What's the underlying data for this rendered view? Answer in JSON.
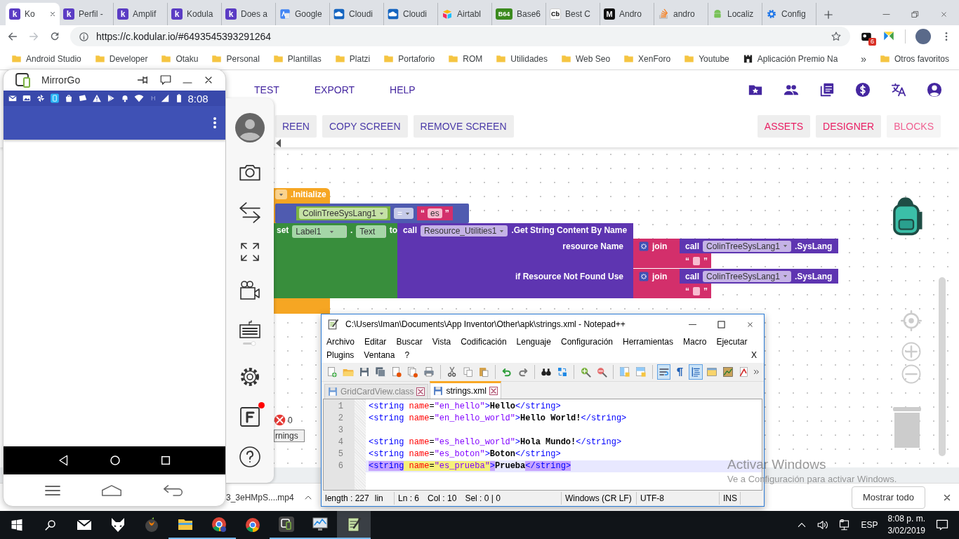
{
  "browser": {
    "tabs": [
      {
        "kind": "kodular",
        "icon_text": "k",
        "label": "Ko",
        "selected": true
      },
      {
        "kind": "kodular",
        "icon_text": "k",
        "label": "Perfil -",
        "selected": false
      },
      {
        "kind": "kodular",
        "icon_text": "k",
        "label": "Amplif",
        "selected": false
      },
      {
        "kind": "kodular",
        "icon_text": "k",
        "label": "Kodula",
        "selected": false
      },
      {
        "kind": "kodular",
        "icon_text": "k",
        "label": "Does a",
        "selected": false
      },
      {
        "kind": "translate",
        "label": "Google",
        "selected": false
      },
      {
        "kind": "cloud",
        "label": "Cloudi",
        "selected": false
      },
      {
        "kind": "cloud",
        "label": "Cloudi",
        "selected": false
      },
      {
        "kind": "airtable",
        "label": "Airtabl",
        "selected": false
      },
      {
        "kind": "b64",
        "icon_text": "B64",
        "label": "Base6",
        "selected": false
      },
      {
        "kind": "cb",
        "icon_text": "Cb",
        "label": "Best C",
        "selected": false
      },
      {
        "kind": "medium",
        "icon_text": "M",
        "label": "Andro",
        "selected": false
      },
      {
        "kind": "stack",
        "label": "andro",
        "selected": false
      },
      {
        "kind": "android",
        "label": "Localiz",
        "selected": false
      },
      {
        "kind": "gear",
        "label": "Config",
        "selected": false
      }
    ],
    "url": "https://c.kodular.io/#6493545393291264",
    "extensions": [
      {
        "kind": "puzzle",
        "badge": "6"
      },
      {
        "kind": "cross"
      }
    ],
    "bookmarks": [
      {
        "kind": "folder",
        "label": "Android Studio"
      },
      {
        "kind": "folder",
        "label": "Developer"
      },
      {
        "kind": "folder",
        "label": "Otaku"
      },
      {
        "kind": "folder",
        "label": "Personal"
      },
      {
        "kind": "folder",
        "label": "Plantillas"
      },
      {
        "kind": "folder",
        "label": "Platzi"
      },
      {
        "kind": "folder",
        "label": "Portaforio"
      },
      {
        "kind": "folder",
        "label": "ROM"
      },
      {
        "kind": "folder",
        "label": "Utilidades"
      },
      {
        "kind": "folder",
        "label": "Web Seo"
      },
      {
        "kind": "folder",
        "label": "XenForo"
      },
      {
        "kind": "folder",
        "label": "Youtube"
      },
      {
        "kind": "site",
        "label": "Aplicación Premio Na"
      }
    ],
    "more": "»",
    "other_bookmarks": "Otros favoritos"
  },
  "kodular": {
    "menu": [
      "TEST",
      "EXPORT",
      "HELP"
    ],
    "screen_buttons": [
      "REEN",
      "COPY SCREEN",
      "REMOVE SCREEN"
    ],
    "editor_buttons": [
      {
        "label": "ASSETS",
        "selected": false
      },
      {
        "label": "DESIGNER",
        "selected": false
      },
      {
        "label": "BLOCKS",
        "selected": true
      }
    ],
    "blocks": [
      {
        "kind": "event",
        "label": ".Initialize"
      },
      {
        "kind": "compare",
        "getter": "ColinTreeSysLang1",
        "operator": "=",
        "string": {
          "open": "“",
          "text": "es",
          "close": "”"
        }
      },
      {
        "kind": "setter",
        "verb": "set",
        "component": "Label1",
        "dot": ".",
        "property": "Text",
        "to": "to"
      },
      {
        "kind": "method",
        "verb": "call",
        "component": "Resource_Utilities1",
        "method": ".Get String Content By Name",
        "sockets": [
          {
            "label": "resource Name",
            "join": "join",
            "call": "call",
            "component": "ColinTreeSysLang1",
            "method": ".SysLang",
            "string": {
              "open": "“",
              "close": "”"
            }
          },
          {
            "label": "if Resource Not Found Use",
            "join": "join",
            "call": "call",
            "component": "ColinTreeSysLang1",
            "method": ".SysLang",
            "string": {
              "open": "“",
              "close": "”"
            }
          }
        ]
      }
    ],
    "warnings": {
      "errors": "0",
      "button": "rnings"
    }
  },
  "mirrorgo": {
    "title": "MirrorGo",
    "network": "H",
    "time": "8:08"
  },
  "notepad": {
    "title": "C:\\Users\\Iman\\Documents\\App Inventor\\Other\\apk\\strings.xml - Notepad++",
    "menu_rows": [
      [
        "Archivo",
        "Editar",
        "Buscar",
        "Vista",
        "Codificación",
        "Lenguaje",
        "Configuración",
        "Herramientas",
        "Macro",
        "Ejecutar"
      ],
      [
        "Plugins",
        "Ventana",
        "?"
      ]
    ],
    "close_doc": "X",
    "toolbar": [
      [
        {
          "kind": "new",
          "pressed": false
        },
        {
          "kind": "open",
          "pressed": false
        },
        {
          "kind": "save",
          "pressed": false
        },
        {
          "kind": "saveall",
          "pressed": false
        },
        {
          "kind": "close",
          "pressed": false
        },
        {
          "kind": "closeall",
          "pressed": false
        },
        {
          "kind": "print",
          "pressed": false
        }
      ],
      [
        {
          "kind": "cut",
          "pressed": false
        },
        {
          "kind": "copy",
          "pressed": false
        },
        {
          "kind": "paste",
          "pressed": false
        }
      ],
      [
        {
          "kind": "undo",
          "pressed": false
        },
        {
          "kind": "redo",
          "pressed": false
        }
      ],
      [
        {
          "kind": "find",
          "pressed": false
        },
        {
          "kind": "replace",
          "pressed": false
        }
      ],
      [
        {
          "kind": "zoomin",
          "pressed": false
        },
        {
          "kind": "zoomout",
          "pressed": false
        }
      ],
      [
        {
          "kind": "syncv",
          "pressed": false
        },
        {
          "kind": "synch",
          "pressed": false
        }
      ],
      [
        {
          "kind": "wrap",
          "pressed": true
        },
        {
          "kind": "pilcrow",
          "pressed": false
        },
        {
          "kind": "indent",
          "pressed": true
        },
        {
          "kind": "panel",
          "pressed": false
        },
        {
          "kind": "map",
          "pressed": false
        },
        {
          "kind": "record",
          "pressed": false
        }
      ]
    ],
    "tabs": [
      {
        "label": "GridCardView.class",
        "selected": false
      },
      {
        "label": "strings.xml",
        "selected": true
      }
    ],
    "lines": [
      {
        "number": "1",
        "current": false,
        "tokens": [
          {
            "kind": "tag",
            "text": "<string"
          },
          {
            "kind": "attr",
            "text": " name"
          },
          {
            "kind": "eq",
            "text": "="
          },
          {
            "kind": "value",
            "text": "\"en_hello\""
          },
          {
            "kind": "tag",
            "text": ">"
          },
          {
            "kind": "text",
            "text": "Hello"
          },
          {
            "kind": "tag",
            "text": "</string>"
          }
        ]
      },
      {
        "number": "2",
        "current": false,
        "tokens": [
          {
            "kind": "tag",
            "text": "<string"
          },
          {
            "kind": "attr",
            "text": " name"
          },
          {
            "kind": "eq",
            "text": "="
          },
          {
            "kind": "value",
            "text": "\"en_hello_world\""
          },
          {
            "kind": "tag",
            "text": ">"
          },
          {
            "kind": "text",
            "text": "Hello World!"
          },
          {
            "kind": "tag",
            "text": "</string>"
          }
        ]
      },
      {
        "number": "3",
        "current": false
      },
      {
        "number": "4",
        "current": false,
        "tokens": [
          {
            "kind": "tag",
            "text": "<string"
          },
          {
            "kind": "attr",
            "text": " name"
          },
          {
            "kind": "eq",
            "text": "="
          },
          {
            "kind": "value",
            "text": "\"es_hello_world\""
          },
          {
            "kind": "tag",
            "text": ">"
          },
          {
            "kind": "text",
            "text": "Hola Mundo!"
          },
          {
            "kind": "tag",
            "text": "</string>"
          }
        ]
      },
      {
        "number": "5",
        "current": false,
        "tokens": [
          {
            "kind": "tag",
            "text": "<string"
          },
          {
            "kind": "attr",
            "text": " name"
          },
          {
            "kind": "eq",
            "text": "="
          },
          {
            "kind": "value",
            "text": "\"es_boton\""
          },
          {
            "kind": "tag",
            "text": ">"
          },
          {
            "kind": "text",
            "text": "Boton"
          },
          {
            "kind": "tag",
            "text": "</string>"
          }
        ]
      },
      {
        "number": "6",
        "current": true,
        "tokens": [
          {
            "kind": "tag",
            "text": "<string",
            "tag_match": true
          },
          {
            "kind": "attr",
            "text": " name",
            "word_match": true
          },
          {
            "kind": "eq",
            "text": "=",
            "word_match": true
          },
          {
            "kind": "value",
            "text": "\"es_prueba\"",
            "word_match": true
          },
          {
            "kind": "tag",
            "text": ">",
            "tag_match": true
          },
          {
            "kind": "text",
            "text": "Prueba"
          },
          {
            "kind": "tag",
            "text": "</string>",
            "tag_match": true
          }
        ]
      }
    ],
    "status": [
      [
        "length : 227",
        "lin"
      ],
      [
        "Ln : 6",
        "Col : 10",
        "Sel : 0 | 0"
      ],
      [
        "Windows (CR LF)"
      ],
      [
        "UTF-8"
      ],
      [
        "INS"
      ]
    ]
  },
  "downloads": {
    "file": "3_3eHMpS....mp4",
    "show_all": "Mostrar todo"
  },
  "activation": {
    "title": "Activar Windows",
    "message": "Ve a Configuración para activar Windows."
  },
  "taskbar": {
    "apps": [
      {
        "kind": "mail",
        "running": false,
        "active": false
      },
      {
        "kind": "fox",
        "running": false,
        "active": false
      },
      {
        "kind": "fl",
        "running": false,
        "active": false
      },
      {
        "kind": "explorer",
        "running": true,
        "active": false
      },
      {
        "kind": "chromeprofile",
        "running": true,
        "active": false
      },
      {
        "kind": "chrome",
        "running": false,
        "active": false
      },
      {
        "kind": "mirrorgo",
        "running": true,
        "active": false
      },
      {
        "kind": "perfmon",
        "running": true,
        "active": false
      },
      {
        "kind": "notepadpp",
        "running": true,
        "active": true
      }
    ],
    "language": "ESP",
    "time": "8:08 p. m.",
    "date": "3/02/2019"
  }
}
